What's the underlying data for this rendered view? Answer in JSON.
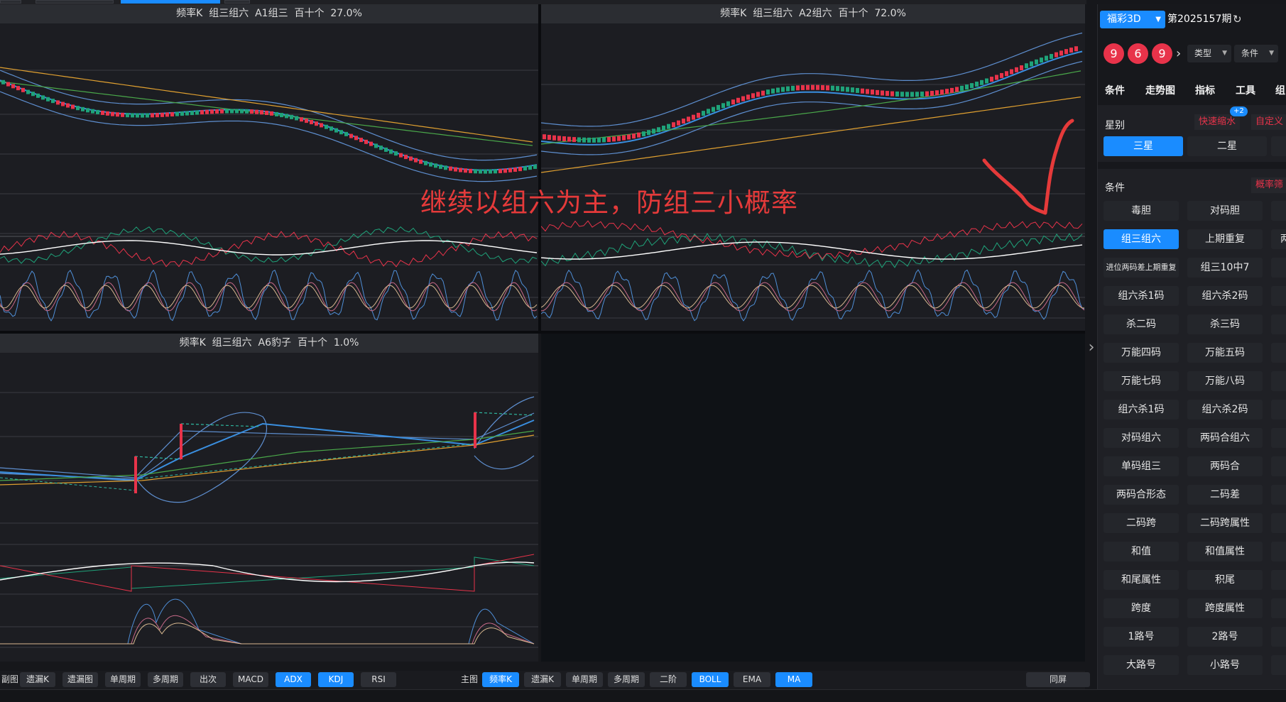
{
  "panels": {
    "a1": {
      "title": "频率K  组三组六  A1组三  百十个  27.0%"
    },
    "a2": {
      "title": "频率K  组三组六  A2组六  百十个  72.0%"
    },
    "a6": {
      "title": "频率K  组三组六  A6豹子  百十个  1.0%"
    }
  },
  "annotation": "继续以组六为主，防组三小概率",
  "bottom_bar": {
    "sub_label": "副图",
    "sub_buttons": [
      {
        "label": "遗漏K",
        "on": false
      },
      {
        "label": "遗漏图",
        "on": false
      },
      {
        "label": "单周期",
        "on": false
      },
      {
        "label": "多周期",
        "on": false
      },
      {
        "label": "出次",
        "on": false
      },
      {
        "label": "MACD",
        "on": false
      },
      {
        "label": "ADX",
        "on": true
      },
      {
        "label": "KDJ",
        "on": true
      },
      {
        "label": "RSI",
        "on": false
      }
    ],
    "main_label": "主图",
    "main_buttons": [
      {
        "label": "频率K",
        "on": true
      },
      {
        "label": "遗漏K",
        "on": false
      },
      {
        "label": "单周期",
        "on": false
      },
      {
        "label": "多周期",
        "on": false
      },
      {
        "label": "二阶",
        "on": false
      },
      {
        "label": "BOLL",
        "on": true
      },
      {
        "label": "EMA",
        "on": false
      },
      {
        "label": "MA",
        "on": true
      }
    ],
    "same_screen": "同屏"
  },
  "sidebar": {
    "lottery": "福彩3D",
    "period": "第2025157期",
    "balls": [
      "9",
      "6",
      "9"
    ],
    "dropdowns": [
      "类型",
      "条件"
    ],
    "nav_tabs": [
      "条件",
      "走势图",
      "指标",
      "工具",
      "组"
    ],
    "star_section": {
      "title": "星别",
      "links": [
        "快速缩水",
        "自定义"
      ],
      "badge": "+2",
      "buttons": [
        {
          "label": "三星",
          "on": true
        },
        {
          "label": "二星",
          "on": false
        }
      ]
    },
    "cond_section": {
      "title": "条件",
      "link": "概率筛",
      "rows": [
        [
          {
            "label": "毒胆"
          },
          {
            "label": "对码胆"
          }
        ],
        [
          {
            "label": "组三组六",
            "on": true
          },
          {
            "label": "上期重复"
          }
        ],
        [
          {
            "label": "进位两码差上期重复",
            "small": true
          },
          {
            "label": "组三10中7"
          }
        ],
        [
          {
            "label": "组六杀1码"
          },
          {
            "label": "组六杀2码"
          }
        ],
        [
          {
            "label": "杀二码"
          },
          {
            "label": "杀三码"
          }
        ],
        [
          {
            "label": "万能四码"
          },
          {
            "label": "万能五码"
          }
        ],
        [
          {
            "label": "万能七码"
          },
          {
            "label": "万能八码"
          }
        ],
        [
          {
            "label": "组六杀1码"
          },
          {
            "label": "组六杀2码"
          }
        ],
        [
          {
            "label": "对码组六"
          },
          {
            "label": "两码合组六"
          }
        ],
        [
          {
            "label": "单码组三"
          },
          {
            "label": "两码合"
          }
        ],
        [
          {
            "label": "两码合形态"
          },
          {
            "label": "二码差"
          }
        ],
        [
          {
            "label": "二码跨"
          },
          {
            "label": "二码跨属性"
          }
        ],
        [
          {
            "label": "和值"
          },
          {
            "label": "和值属性"
          }
        ],
        [
          {
            "label": "和尾属性"
          },
          {
            "label": "积尾"
          }
        ],
        [
          {
            "label": "跨度"
          },
          {
            "label": "跨度属性"
          }
        ],
        [
          {
            "label": "1路号"
          },
          {
            "label": "2路号"
          }
        ],
        [
          {
            "label": "大路号"
          },
          {
            "label": "小路号"
          }
        ]
      ],
      "extra_col": [
        "两"
      ]
    }
  },
  "colors": {
    "accent": "#1a8cff",
    "up_candle": "#e8334a",
    "down_candle": "#1fa37a",
    "ma_orange": "#e0a030",
    "ma_green": "#4aa84a",
    "ma_blue": "#3a8fe0",
    "annotation_red": "#e53a3a"
  }
}
